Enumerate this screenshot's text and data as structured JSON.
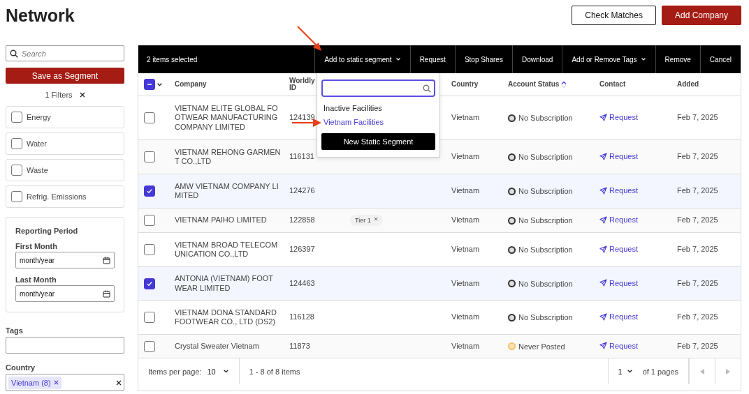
{
  "title": "Network",
  "header_buttons": [
    {
      "label": "Check Matches",
      "kind": "outline"
    },
    {
      "label": "Add Company",
      "kind": "primary"
    }
  ],
  "sidebar": {
    "search": {
      "placeholder": "Search"
    },
    "save_button": "Save as Segment",
    "filters_label": "1 Filters",
    "metric_filters": [
      {
        "label": "Energy",
        "checked": false
      },
      {
        "label": "Water",
        "checked": false
      },
      {
        "label": "Waste",
        "checked": false
      },
      {
        "label": "Refrig. Emissions",
        "checked": false
      }
    ],
    "reporting_period": {
      "title": "Reporting Period",
      "fields": [
        {
          "label": "First Month",
          "placeholder": "month/year"
        },
        {
          "label": "Last Month",
          "placeholder": "month/year"
        }
      ]
    },
    "tags": {
      "label": "Tags"
    },
    "country": {
      "label": "Country",
      "chips": [
        "Vietnam (8)"
      ]
    }
  },
  "toolbar": {
    "selection_text": "2 items selected",
    "actions": [
      {
        "label": "Add to static segment",
        "has_menu": true
      },
      {
        "label": "Request",
        "has_menu": false
      },
      {
        "label": "Stop Shares",
        "has_menu": false
      },
      {
        "label": "Download",
        "has_menu": false
      },
      {
        "label": "Add or Remove Tags",
        "has_menu": true
      },
      {
        "label": "Remove",
        "has_menu": false
      },
      {
        "label": "Cancel",
        "has_menu": false
      }
    ]
  },
  "segment_menu": {
    "options": [
      {
        "label": "Inactive Facilities",
        "selected": false
      },
      {
        "label": "Vietnam Facilities",
        "selected": true
      }
    ],
    "button": "New Static Segment"
  },
  "table": {
    "select_all_partial": true,
    "columns": [
      {
        "label": "Company",
        "sorted": false
      },
      {
        "label": "Worldly ID",
        "sorted": false
      },
      {
        "label": "Country",
        "sorted": false
      },
      {
        "label": "Account Status",
        "sorted": true
      },
      {
        "label": "Contact",
        "sorted": false
      },
      {
        "label": "Added",
        "sorted": false
      }
    ],
    "rows": [
      {
        "checked": false,
        "company": "VIETNAM ELITE GLOBAL FO OTWEAR MANUFACTURING COMPANY LIMITED",
        "id": "124139",
        "country": "Vietnam",
        "status": {
          "label": "No Subscription",
          "color": "#333333"
        },
        "contact": "Request",
        "added": "Feb 7, 2025"
      },
      {
        "checked": false,
        "company": "VIETNAM REHONG GARMEN T CO.,LTD",
        "id": "116131",
        "country": "Vietnam",
        "status": {
          "label": "No Subscription",
          "color": "#333333"
        },
        "contact": "Request",
        "added": "Feb 7, 2025"
      },
      {
        "checked": true,
        "company": "AMW VIETNAM COMPANY LI MITED",
        "id": "124276",
        "country": "Vietnam",
        "status": {
          "label": "No Subscription",
          "color": "#333333"
        },
        "contact": "Request",
        "added": "Feb 7, 2025"
      },
      {
        "checked": false,
        "company": "VIETNAM PAIHO LIMITED",
        "id": "122858",
        "tag": "Tier 1",
        "country": "Vietnam",
        "status": {
          "label": "No Subscription",
          "color": "#333333"
        },
        "contact": "Request",
        "added": "Feb 7, 2025"
      },
      {
        "checked": false,
        "company": "VIETNAM BROAD TELECOM UNICATION CO.,LTD",
        "id": "126397",
        "country": "Vietnam",
        "status": {
          "label": "No Subscription",
          "color": "#333333"
        },
        "contact": "Request",
        "added": "Feb 7, 2025"
      },
      {
        "checked": true,
        "company": "ANTONIA (VIETNAM) FOOT WEAR LIMITED",
        "id": "124463",
        "country": "Vietnam",
        "status": {
          "label": "No Subscription",
          "color": "#333333"
        },
        "contact": "Request",
        "added": "Feb 7, 2025"
      },
      {
        "checked": false,
        "company": "VIETNAM DONA STANDARD FOOTWEAR CO., LTD (DS2)",
        "id": "116128",
        "country": "Vietnam",
        "status": {
          "label": "No Subscription",
          "color": "#333333"
        },
        "contact": "Request",
        "added": "Feb 7, 2025"
      },
      {
        "checked": false,
        "company": "Crystal Sweater Vietnam",
        "id": "11873",
        "country": "Vietnam",
        "status": {
          "label": "Never Posted",
          "color": "#f5c26b"
        },
        "contact": "Request",
        "added": "Feb 7, 2025"
      }
    ]
  },
  "footer": {
    "per_page_label": "Items per page:",
    "per_page": "10",
    "range": "1 - 8 of 8 items",
    "page": "1",
    "pages_label": "of 1 pages"
  }
}
